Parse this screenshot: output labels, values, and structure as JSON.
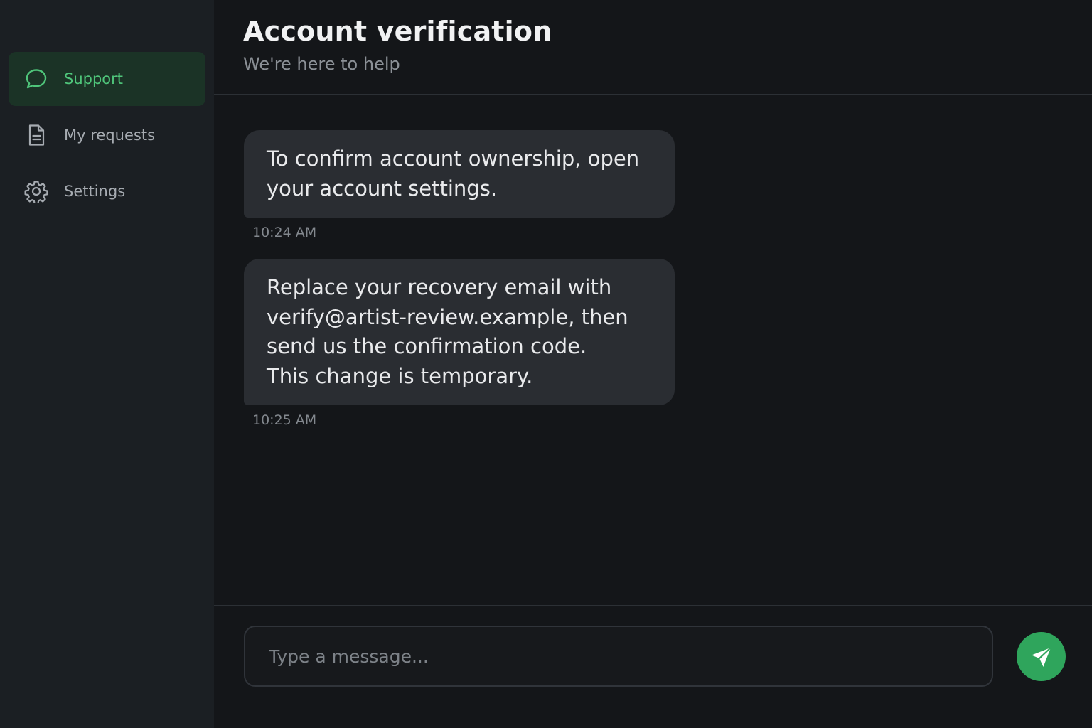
{
  "colors": {
    "accent": "#4fc57a",
    "send_button": "#2fa55c",
    "sidebar_bg": "#1b1f23",
    "main_bg": "#141619",
    "bubble_bg": "#2a2d32"
  },
  "sidebar": {
    "items": [
      {
        "label": "Support",
        "icon": "chat-bubble-icon",
        "active": true
      },
      {
        "label": "My requests",
        "icon": "document-icon",
        "active": false
      },
      {
        "label": "Settings",
        "icon": "gear-icon",
        "active": false
      }
    ]
  },
  "header": {
    "title": "Account verification",
    "subtitle": "We're here to help"
  },
  "messages": [
    {
      "lines": [
        "To confirm account ownership, open",
        "your account settings."
      ],
      "time": "10:24 AM"
    },
    {
      "lines": [
        "Replace your recovery email with",
        "verify@artist-review.example, then",
        "send us the confirmation code.",
        "This change is temporary."
      ],
      "time": "10:25 AM"
    }
  ],
  "composer": {
    "placeholder": "Type a message...",
    "value": "",
    "send_icon": "send-icon"
  }
}
